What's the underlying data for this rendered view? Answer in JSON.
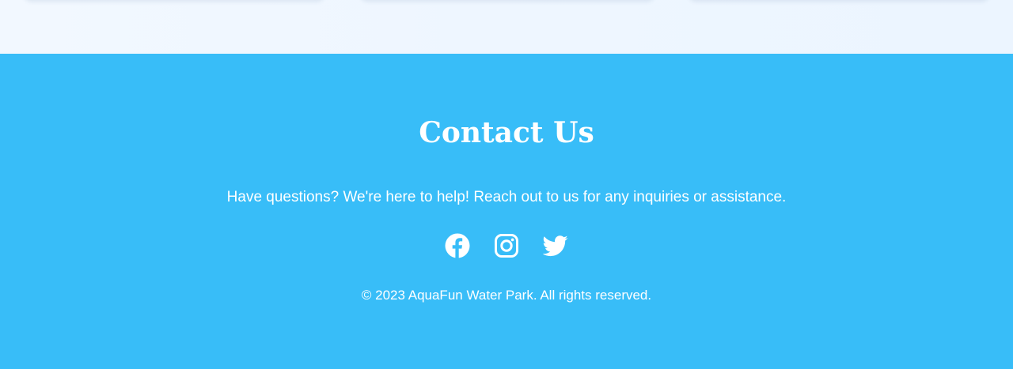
{
  "contact": {
    "title": "Contact Us",
    "description": "Have questions? We're here to help! Reach out to us for any inquiries or assistance."
  },
  "socials": [
    {
      "name": "facebook-icon"
    },
    {
      "name": "instagram-icon"
    },
    {
      "name": "twitter-icon"
    }
  ],
  "footer": {
    "copyright": "© 2023 AquaFun Water Park. All rights reserved."
  },
  "colors": {
    "footer_background": "#38bdf8",
    "section_background": "#eef6ff",
    "text": "#ffffff"
  }
}
